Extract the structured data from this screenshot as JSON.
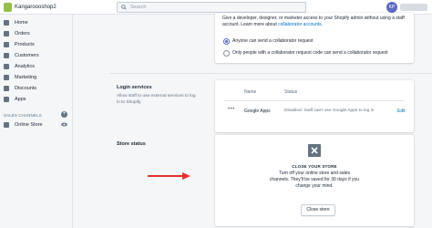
{
  "topbar": {
    "store_name": "Kangaroooshop2",
    "search_placeholder": "Search",
    "avatar_initials": "KP"
  },
  "sidebar": {
    "items": [
      {
        "label": "Home",
        "icon": "home-icon"
      },
      {
        "label": "Orders",
        "icon": "orders-icon"
      },
      {
        "label": "Products",
        "icon": "tag-icon"
      },
      {
        "label": "Customers",
        "icon": "person-icon"
      },
      {
        "label": "Analytics",
        "icon": "chart-icon"
      },
      {
        "label": "Marketing",
        "icon": "megaphone-icon"
      },
      {
        "label": "Discounts",
        "icon": "discount-icon"
      },
      {
        "label": "Apps",
        "icon": "apps-icon"
      }
    ],
    "sales_channels_header": "SALES CHANNELS",
    "online_store_label": "Online Store"
  },
  "collaborators": {
    "description": "Give a developer, designer, or marketer access to your Shopify admin without using a staff account. Learn more about",
    "link_text": "collaborator accounts.",
    "options": [
      {
        "label": "Anyone can send a collaborator request",
        "selected": true
      },
      {
        "label": "Only people with a collaborator request code can send a collaborator request",
        "selected": false
      }
    ]
  },
  "login_services": {
    "title": "Login services",
    "description": "Allow staff to use external services to log in to Shopify.",
    "columns": [
      "Name",
      "Status"
    ],
    "rows": [
      {
        "name": "Google Apps",
        "status": "Disabled: Staff can't use Google Apps to log in",
        "action": "Edit"
      }
    ]
  },
  "store_status": {
    "title": "Store status",
    "close_title": "CLOSE YOUR STORE",
    "close_description": "Turn off your online store and sales channels. They'll be saved for 30 days if you change your mind.",
    "close_button": "Close store"
  },
  "colors": {
    "accent": "#5c6ac4",
    "link": "#006fbb",
    "arrow": "#e4312a"
  }
}
